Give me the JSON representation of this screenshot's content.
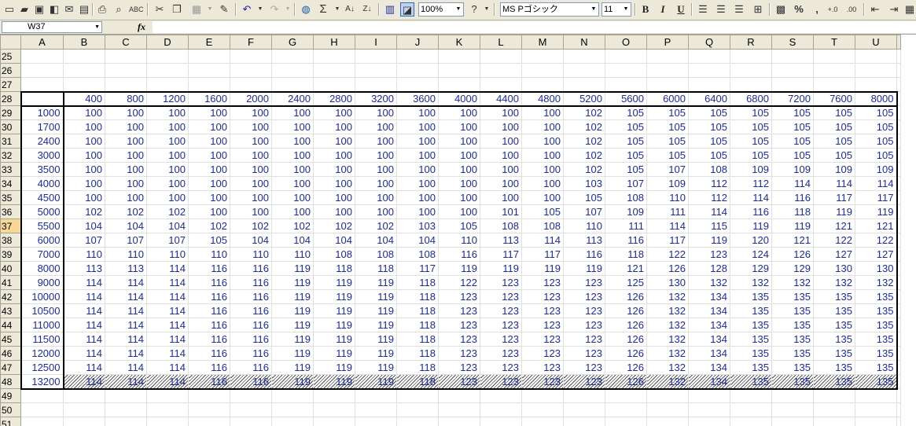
{
  "toolbar": {
    "zoom": "100%",
    "font_name": "MS Pゴシック",
    "font_size": "11",
    "bold": "B",
    "italic": "I",
    "underline": "U",
    "sigma": "Σ",
    "percent": "%",
    "comma": ","
  },
  "formula_bar": {
    "cell_ref": "W37",
    "fx": "fx",
    "value": ""
  },
  "sheet": {
    "columns": [
      "A",
      "B",
      "C",
      "D",
      "E",
      "F",
      "G",
      "H",
      "I",
      "J",
      "K",
      "L",
      "M",
      "N",
      "O",
      "P",
      "Q",
      "R",
      "S",
      "T",
      "U"
    ],
    "active_row": 37,
    "col_headers_values": [
      "400",
      "800",
      "1200",
      "1600",
      "2000",
      "2400",
      "2800",
      "3200",
      "3600",
      "4000",
      "4400",
      "4800",
      "5200",
      "5600",
      "6000",
      "6400",
      "6800",
      "7200",
      "7600",
      "8000"
    ],
    "table_first_row": 28,
    "first_visible_row": 25,
    "rows": [
      {
        "a": "1000",
        "v": [
          "100",
          "100",
          "100",
          "100",
          "100",
          "100",
          "100",
          "100",
          "100",
          "100",
          "100",
          "100",
          "102",
          "105",
          "105",
          "105",
          "105",
          "105",
          "105",
          "105"
        ]
      },
      {
        "a": "1700",
        "v": [
          "100",
          "100",
          "100",
          "100",
          "100",
          "100",
          "100",
          "100",
          "100",
          "100",
          "100",
          "100",
          "102",
          "105",
          "105",
          "105",
          "105",
          "105",
          "105",
          "105"
        ]
      },
      {
        "a": "2400",
        "v": [
          "100",
          "100",
          "100",
          "100",
          "100",
          "100",
          "100",
          "100",
          "100",
          "100",
          "100",
          "100",
          "102",
          "105",
          "105",
          "105",
          "105",
          "105",
          "105",
          "105"
        ]
      },
      {
        "a": "3000",
        "v": [
          "100",
          "100",
          "100",
          "100",
          "100",
          "100",
          "100",
          "100",
          "100",
          "100",
          "100",
          "100",
          "102",
          "105",
          "105",
          "105",
          "105",
          "105",
          "105",
          "105"
        ]
      },
      {
        "a": "3500",
        "v": [
          "100",
          "100",
          "100",
          "100",
          "100",
          "100",
          "100",
          "100",
          "100",
          "100",
          "100",
          "100",
          "102",
          "105",
          "107",
          "108",
          "109",
          "109",
          "109",
          "109"
        ]
      },
      {
        "a": "4000",
        "v": [
          "100",
          "100",
          "100",
          "100",
          "100",
          "100",
          "100",
          "100",
          "100",
          "100",
          "100",
          "100",
          "103",
          "107",
          "109",
          "112",
          "112",
          "114",
          "114",
          "114"
        ]
      },
      {
        "a": "4500",
        "v": [
          "100",
          "100",
          "100",
          "100",
          "100",
          "100",
          "100",
          "100",
          "100",
          "100",
          "100",
          "100",
          "105",
          "108",
          "110",
          "112",
          "114",
          "116",
          "117",
          "117"
        ]
      },
      {
        "a": "5000",
        "v": [
          "102",
          "102",
          "102",
          "100",
          "100",
          "100",
          "100",
          "100",
          "100",
          "100",
          "101",
          "105",
          "107",
          "109",
          "111",
          "114",
          "116",
          "118",
          "119",
          "119"
        ]
      },
      {
        "a": "5500",
        "v": [
          "104",
          "104",
          "104",
          "102",
          "102",
          "102",
          "102",
          "102",
          "103",
          "105",
          "108",
          "108",
          "110",
          "111",
          "114",
          "115",
          "119",
          "119",
          "121",
          "121"
        ]
      },
      {
        "a": "6000",
        "v": [
          "107",
          "107",
          "107",
          "105",
          "104",
          "104",
          "104",
          "104",
          "104",
          "110",
          "113",
          "114",
          "113",
          "116",
          "117",
          "119",
          "120",
          "121",
          "122",
          "122"
        ]
      },
      {
        "a": "7000",
        "v": [
          "110",
          "110",
          "110",
          "110",
          "110",
          "110",
          "108",
          "108",
          "108",
          "116",
          "117",
          "117",
          "116",
          "118",
          "122",
          "123",
          "124",
          "126",
          "127",
          "127"
        ]
      },
      {
        "a": "8000",
        "v": [
          "113",
          "113",
          "114",
          "116",
          "116",
          "119",
          "118",
          "118",
          "117",
          "119",
          "119",
          "119",
          "119",
          "121",
          "126",
          "128",
          "129",
          "129",
          "130",
          "130"
        ]
      },
      {
        "a": "9000",
        "v": [
          "114",
          "114",
          "114",
          "116",
          "116",
          "119",
          "119",
          "119",
          "118",
          "122",
          "123",
          "123",
          "123",
          "125",
          "130",
          "132",
          "132",
          "132",
          "132",
          "132"
        ]
      },
      {
        "a": "10000",
        "v": [
          "114",
          "114",
          "114",
          "116",
          "116",
          "119",
          "119",
          "119",
          "118",
          "123",
          "123",
          "123",
          "123",
          "126",
          "132",
          "134",
          "135",
          "135",
          "135",
          "135"
        ]
      },
      {
        "a": "10500",
        "v": [
          "114",
          "114",
          "114",
          "116",
          "116",
          "119",
          "119",
          "119",
          "118",
          "123",
          "123",
          "123",
          "123",
          "126",
          "132",
          "134",
          "135",
          "135",
          "135",
          "135"
        ]
      },
      {
        "a": "11000",
        "v": [
          "114",
          "114",
          "114",
          "116",
          "116",
          "119",
          "119",
          "119",
          "118",
          "123",
          "123",
          "123",
          "123",
          "126",
          "132",
          "134",
          "135",
          "135",
          "135",
          "135"
        ]
      },
      {
        "a": "11500",
        "v": [
          "114",
          "114",
          "114",
          "116",
          "116",
          "119",
          "119",
          "119",
          "118",
          "123",
          "123",
          "123",
          "123",
          "126",
          "132",
          "134",
          "135",
          "135",
          "135",
          "135"
        ]
      },
      {
        "a": "12000",
        "v": [
          "114",
          "114",
          "114",
          "116",
          "116",
          "119",
          "119",
          "119",
          "118",
          "123",
          "123",
          "123",
          "123",
          "126",
          "132",
          "134",
          "135",
          "135",
          "135",
          "135"
        ]
      },
      {
        "a": "12500",
        "v": [
          "114",
          "114",
          "114",
          "116",
          "116",
          "119",
          "119",
          "119",
          "118",
          "123",
          "123",
          "123",
          "123",
          "126",
          "132",
          "134",
          "135",
          "135",
          "135",
          "135"
        ]
      },
      {
        "a": "13200",
        "v": [
          "114",
          "114",
          "114",
          "116",
          "116",
          "119",
          "119",
          "119",
          "118",
          "123",
          "123",
          "123",
          "123",
          "126",
          "132",
          "134",
          "135",
          "135",
          "135",
          "135"
        ]
      }
    ],
    "trailing_rows": [
      49,
      50,
      51
    ]
  }
}
